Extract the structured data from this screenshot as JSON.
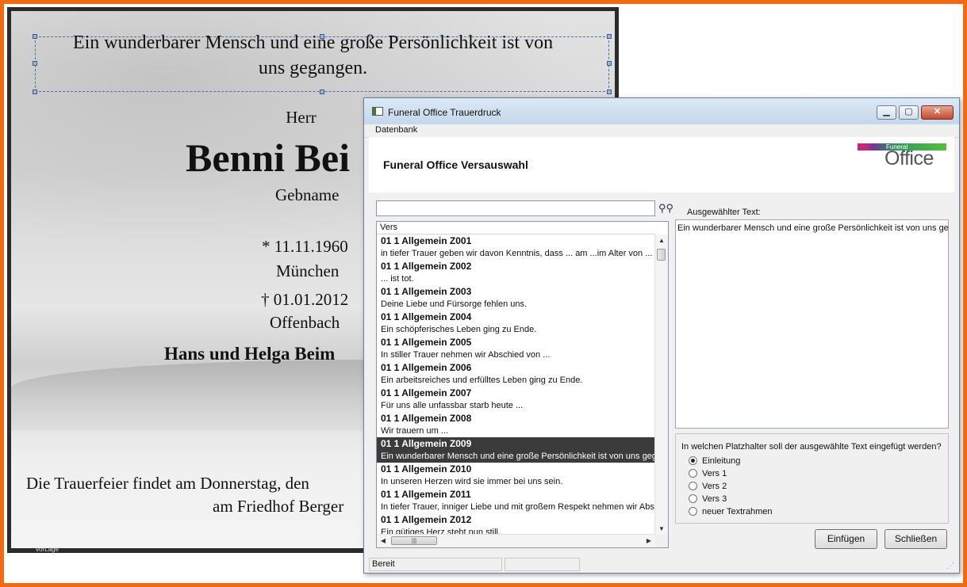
{
  "document": {
    "headline_line1": "Ein wunderbarer Mensch und eine große Persönlichkeit ist von",
    "headline_line2": "uns gegangen.",
    "salutation": "Herr",
    "name": "Benni Bei",
    "birthname": "Gebname",
    "birth_date": "* 11.11.1960",
    "birth_place": "München",
    "death_date": "† 01.01.2012",
    "death_place": "Offenbach",
    "mourners": "Hans und Helga Beim",
    "ceremony_line1": "Die Trauerfeier findet am Donnerstag, den",
    "ceremony_line2": "am Friedhof Berger",
    "footer_mark": "vorLage"
  },
  "window": {
    "title": "Funeral Office Trauerdruck",
    "minimize": "▁",
    "maximize": "▢",
    "close": "✕",
    "menu": [
      "Datenbank"
    ],
    "header_title": "Funeral Office Versauswahl",
    "logo_small": "Funeral",
    "logo_big": "Office",
    "search_value": "",
    "search_icon": "binoculars-icon",
    "binoc_glyph": "⚲⚲",
    "list_header": "Vers",
    "scroll_up": "▲",
    "scroll_down": "▼",
    "scroll_left": "◀",
    "scroll_right": "▶",
    "hthumb_grip": "|||",
    "list_rows": [
      {
        "title": "01 1 Allgemein Z001",
        "text": "in tiefer Trauer geben wir davon Kenntnis, dass ... am ...im Alter von ... ges"
      },
      {
        "title": "01 1 Allgemein Z002",
        "text": "... ist tot."
      },
      {
        "title": "01 1 Allgemein Z003",
        "text": "Deine Liebe und Fürsorge fehlen uns."
      },
      {
        "title": "01 1 Allgemein Z004",
        "text": "Ein schöpferisches Leben ging zu Ende."
      },
      {
        "title": "01 1 Allgemein Z005",
        "text": "In stiller Trauer nehmen wir Abschied von ..."
      },
      {
        "title": "01 1 Allgemein Z006",
        "text": "Ein arbeitsreiches und erfülltes Leben ging zu Ende."
      },
      {
        "title": "01 1 Allgemein Z007",
        "text": "Für uns alle unfassbar starb heute ..."
      },
      {
        "title": "01 1 Allgemein Z008",
        "text": "Wir trauern um ..."
      },
      {
        "title": "01 1 Allgemein Z009",
        "text": "Ein wunderbarer Mensch und eine große Persönlichkeit ist von uns gegan",
        "selected": true
      },
      {
        "title": "01 1 Allgemein Z010",
        "text": "In unseren Herzen wird sie immer bei uns sein."
      },
      {
        "title": "01 1 Allgemein Z011",
        "text": "In tiefer Trauer, inniger Liebe und mit großem Respekt nehmen wir Abschi"
      },
      {
        "title": "01 1 Allgemein Z012",
        "text": "Ein gütiges Herz steht nun still."
      }
    ],
    "selected_label": "Ausgewählter Text:",
    "selected_text": "Ein wunderbarer Mensch und eine große Persönlichkeit ist von uns geg",
    "placeholder_question": "In welchen Platzhalter soll der ausgewählte Text eingefügt werden?",
    "radio_options": [
      {
        "label": "Einleitung",
        "checked": true
      },
      {
        "label": "Vers 1",
        "checked": false
      },
      {
        "label": "Vers 2",
        "checked": false
      },
      {
        "label": "Vers 3",
        "checked": false
      },
      {
        "label": "neuer Textrahmen",
        "checked": false
      }
    ],
    "insert_button": "Einfügen",
    "close_button": "Schließen",
    "status": "Bereit",
    "grip_glyph": "⋰"
  },
  "colors": {
    "frame": "#f26a10",
    "selected_row": "#3b3b3b",
    "logo_magenta": "#c0297a",
    "logo_green": "#5abf3e"
  }
}
